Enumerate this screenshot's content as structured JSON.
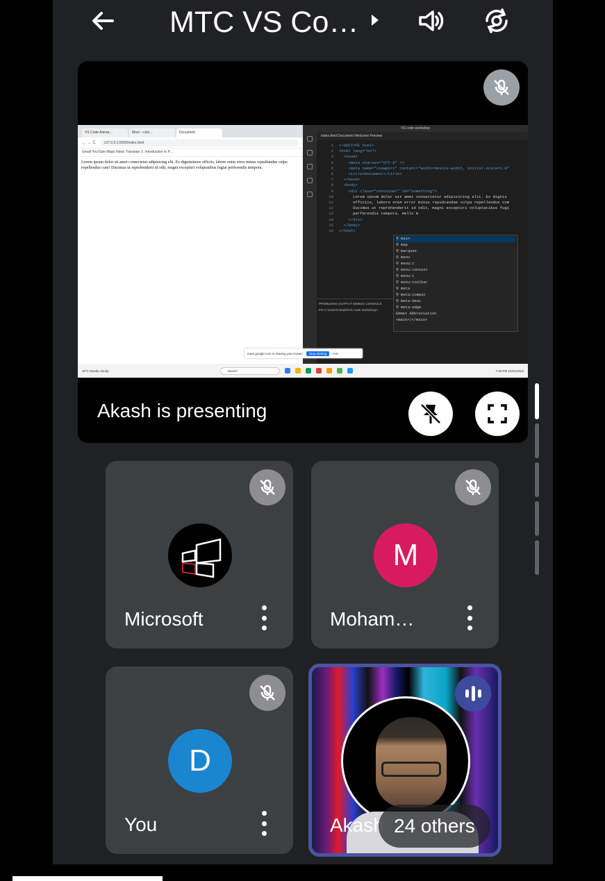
{
  "header": {
    "title": "MTC VS Co…"
  },
  "presentation": {
    "presenting_label": "Akash is presenting",
    "browser": {
      "tabs": [
        "VS Code Anima…",
        "Mozi – cols…",
        "Document"
      ],
      "url": "127.0.0.1:5500/index.html",
      "bookmarks": "Gmail   YouTube   Maps   News   Translate   2. Introduction to P…",
      "page_text": "Lorem ipsum dolor sit amet consectetur adipisicing elit. Ex dignissimos officiis, labore enim error minus repudiandae culpa repellendus cum! Ducimus ut reprehenderit id odit, magni excepturi voluptatibus fugiat perferendis tempora."
    },
    "vscode": {
      "title": "VS code workshop",
      "tabs": "index.html   Document   Welcome   Preview",
      "code": [
        {
          "n": "1",
          "t": "<!DOCTYPE html>"
        },
        {
          "n": "2",
          "t": "<html lang=\"en\">"
        },
        {
          "n": "3",
          "t": "  <head>"
        },
        {
          "n": "4",
          "t": "    <meta charset=\"UTF-8\" />"
        },
        {
          "n": "5",
          "t": "    <meta name=\"viewport\" content=\"width=device-width, initial-scale=1.0\""
        },
        {
          "n": "6",
          "t": "    <title>Document</title>"
        },
        {
          "n": "7",
          "t": "  </head>"
        },
        {
          "n": "8",
          "t": "  <body>"
        },
        {
          "n": "9",
          "t": "    <div class=\"container\" id=\"something\">"
        },
        {
          "n": "10",
          "t": "      Lorem ipsum dolor sit amet consectetur adipisicing elit. Ex dignis"
        },
        {
          "n": "11",
          "t": "      officiis, labore enim error minus repudiandae culpa repellendus cum"
        },
        {
          "n": "12",
          "t": "      Ducimus ut reprehenderit id odit, magni excepturi voluptatibus fugi"
        },
        {
          "n": "13",
          "t": "      perferendis tempora. Hello m"
        },
        {
          "n": "14",
          "t": "    </div>"
        },
        {
          "n": "15",
          "t": "  </body>"
        },
        {
          "n": "16",
          "t": "</html>"
        }
      ],
      "suggestions": [
        "main",
        "map",
        "marquee",
        "menu",
        "menu:c",
        "menu:context",
        "menu:t",
        "menu:toolbar",
        "meta",
        "meta:compat",
        "meta:desc",
        "meta:edge",
        "Emmet Abbreviation",
        "<main>|</main>"
      ],
      "terminal_tabs": "PROBLEMS   OUTPUT   DEBUG CONSOLE",
      "terminal_line": "PS C:\\Users\\Akash\\VS code workshop>"
    },
    "notification": {
      "text": "meet.google.com is sharing your screen.",
      "stop_label": "Stop sharing",
      "hide_label": "Hide"
    },
    "taskbar": {
      "weather": "28°C Mostly cloudy",
      "search": "Search",
      "clock": "7:49 PM 10/31/2022"
    }
  },
  "participants": [
    {
      "name": "Microsoft",
      "avatar_letter": "",
      "avatar_color": "#000000"
    },
    {
      "name": "Moham…",
      "avatar_letter": "M",
      "avatar_color": "#d81b60"
    },
    {
      "name": "You",
      "avatar_letter": "D",
      "avatar_color": "#1a86d0"
    }
  ],
  "speaker": {
    "name": "Akash",
    "others_label": "24 others"
  },
  "icons": {
    "back": "arrow-left-icon",
    "title_chevron": "chevron-right-icon",
    "speaker": "volume-icon",
    "switch_camera": "camera-switch-icon",
    "mic_off": "mic-off-icon",
    "unpin": "unpin-icon",
    "fullscreen": "fullscreen-icon",
    "more": "more-vertical-icon",
    "audio": "audio-level-icon"
  }
}
